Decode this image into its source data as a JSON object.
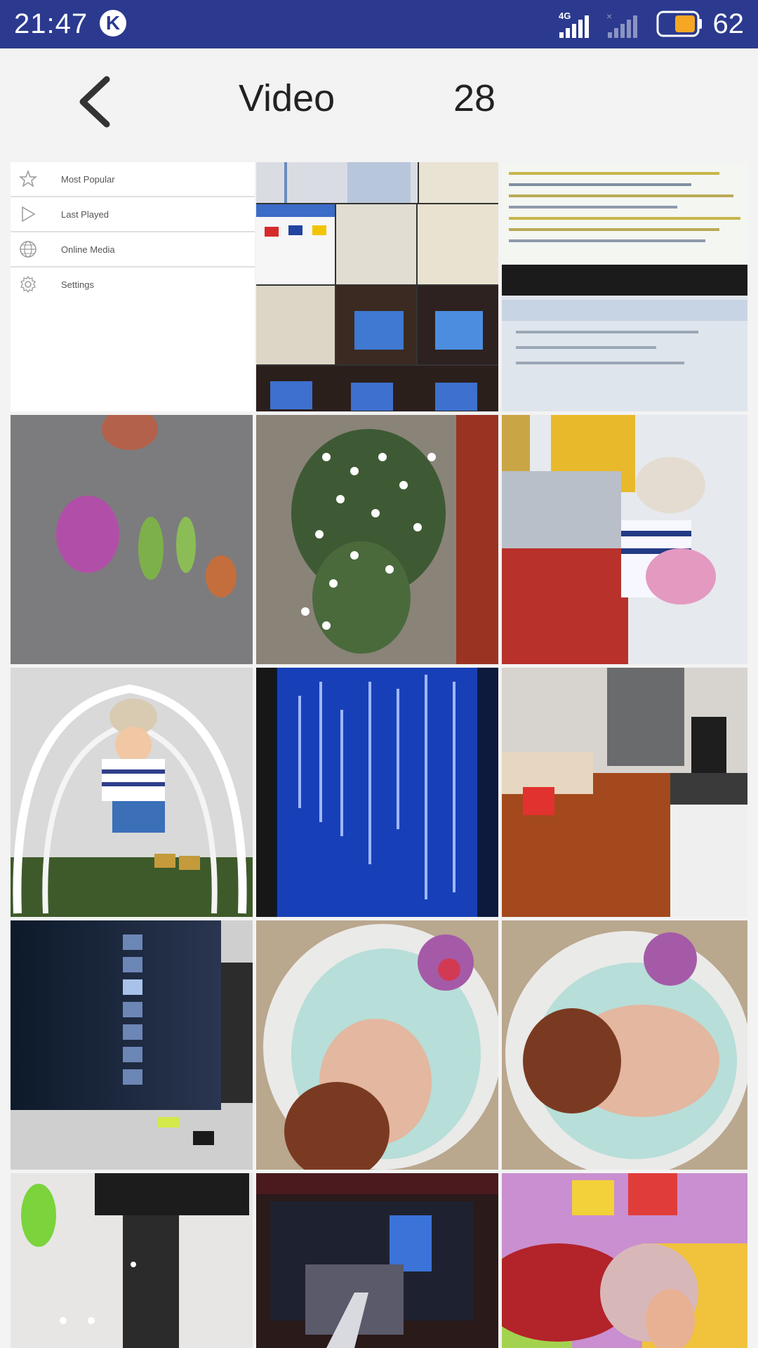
{
  "status": {
    "time": "21:47",
    "k_badge": "K",
    "network": "4G",
    "battery": "62",
    "colors": {
      "bar": "#2b3a8f",
      "battery_fill": "#f5a623"
    }
  },
  "header": {
    "title": "Video",
    "count": "28",
    "back_icon": "chevron-left-icon"
  },
  "menu": {
    "items": [
      {
        "label": "Most Popular",
        "icon": "star-icon"
      },
      {
        "label": "Last Played",
        "icon": "play-icon"
      },
      {
        "label": "Online Media",
        "icon": "globe-icon"
      },
      {
        "label": "Settings",
        "icon": "gear-icon"
      }
    ]
  },
  "thumbnails": [
    {
      "subject": "screens-collage"
    },
    {
      "subject": "code-screen-laptop"
    },
    {
      "subject": "blurred-flowers"
    },
    {
      "subject": "white-flowering-plant"
    },
    {
      "subject": "child-at-counter"
    },
    {
      "subject": "child-in-swing-chair"
    },
    {
      "subject": "blue-code-monitor"
    },
    {
      "subject": "living-room"
    },
    {
      "subject": "tv-channel-list"
    },
    {
      "subject": "baby-in-tub"
    },
    {
      "subject": "baby-in-tub-2"
    },
    {
      "subject": "glass-table"
    },
    {
      "subject": "night-street"
    },
    {
      "subject": "baby-on-playmat"
    }
  ]
}
